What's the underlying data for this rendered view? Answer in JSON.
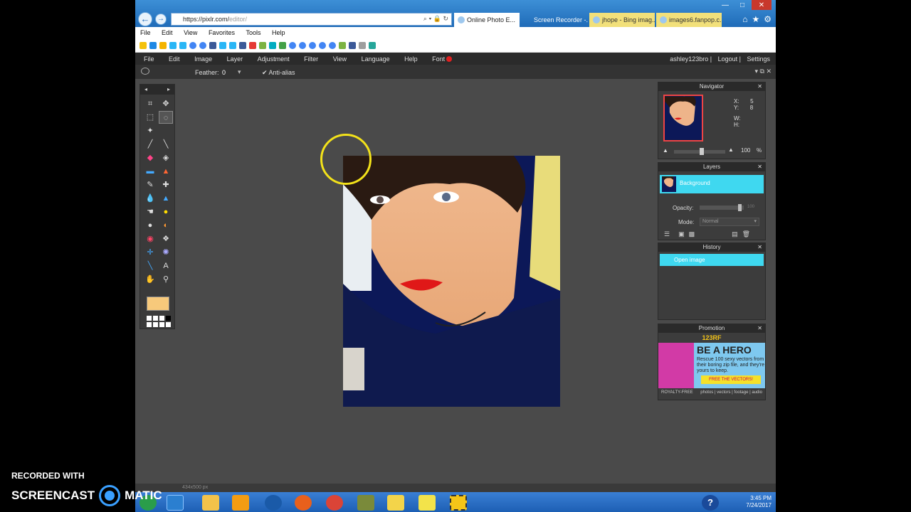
{
  "ie": {
    "address": "https://pixlr.com/",
    "address_dim": "editor/",
    "tabs": [
      {
        "label": "Online Photo E...",
        "active": true
      },
      {
        "label": "Screen Recorder -...",
        "active": false
      },
      {
        "label": "jhope - Bing imag...",
        "active": false
      },
      {
        "label": "images6.fanpop.c...",
        "active": false
      }
    ],
    "menu": [
      "File",
      "Edit",
      "View",
      "Favorites",
      "Tools",
      "Help"
    ],
    "win_controls": [
      "—",
      "□",
      "✕"
    ]
  },
  "pixlr": {
    "menu": [
      "File",
      "Edit",
      "Image",
      "Layer",
      "Adjustment",
      "Filter",
      "View",
      "Language",
      "Help",
      "Font"
    ],
    "user": "ashley123bro",
    "logout": "Logout",
    "settings": "Settings",
    "feather_label": "Feather:",
    "feather_value": "0",
    "antialias_label": "Anti-alias"
  },
  "navigator": {
    "title": "Navigator",
    "x_label": "X:",
    "x_value": "5",
    "y_label": "Y:",
    "y_value": "8",
    "w_label": "W:",
    "h_label": "H:",
    "zoom": "100",
    "zoom_unit": "%"
  },
  "layers": {
    "title": "Layers",
    "layer_name": "Background",
    "opacity_label": "Opacity:",
    "opacity_value": "100",
    "mode_label": "Mode:",
    "mode_value": "Normal"
  },
  "history": {
    "title": "History",
    "entry": "Open image"
  },
  "promotion": {
    "title": "Promotion",
    "brand": "123RF",
    "headline": "BE A HERO",
    "body": "Rescue 100 sexy vectors from their boring zip file, and they're yours to keep.",
    "cta": "FREE THE VECTORS!",
    "footer_left": "ROYALTY-FREE",
    "footer_right": "photos | vectors | footage | audio"
  },
  "status_bar": "434x500 px",
  "taskbar": {
    "time": "3:45 PM",
    "date": "7/24/2017"
  },
  "watermark": {
    "line1": "RECORDED WITH",
    "left": "SCREENCAST",
    "right": "MATIC"
  }
}
